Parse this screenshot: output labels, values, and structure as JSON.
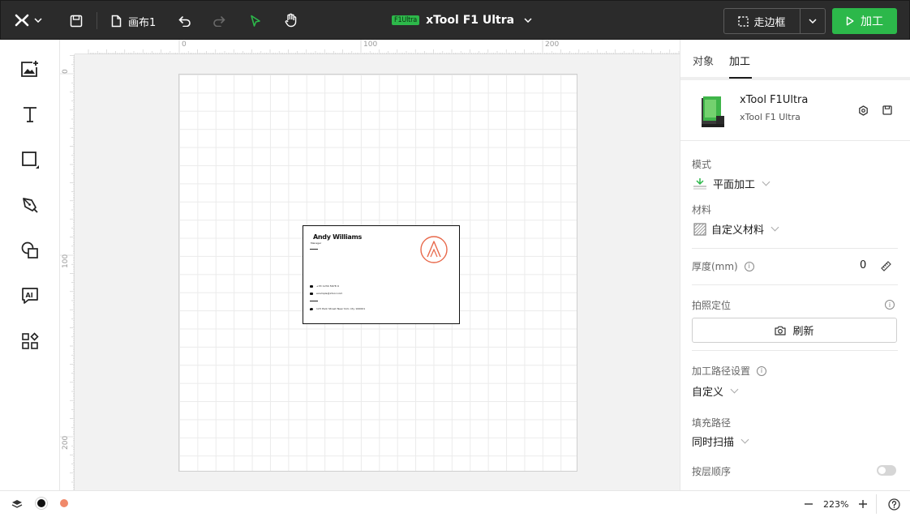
{
  "topbar": {
    "canvas_name": "画布1",
    "device_badge": "F1Ultra",
    "device_title": "xTool F1 Ultra",
    "frame_label": "走边框",
    "process_label": "加工"
  },
  "ruler": {
    "top_ticks": [
      "0",
      "100",
      "200"
    ],
    "left_ticks": [
      "0",
      "100",
      "200"
    ]
  },
  "card": {
    "name": "Andy Williams",
    "role": "Manager",
    "phone": "+33 1234 5678 9",
    "email": "example@xtool.com",
    "address": "123 Park Street New York city 100001"
  },
  "panel": {
    "tabs": [
      "对象",
      "加工"
    ],
    "active_tab": "加工",
    "device_name": "xTool F1Ultra",
    "device_model": "xTool F1 Ultra",
    "mode_label": "模式",
    "mode_value": "平面加工",
    "material_label": "材料",
    "material_value": "自定义材料",
    "thickness_label": "厚度(mm)",
    "thickness_value": "0",
    "camera_label": "拍照定位",
    "refresh_label": "刷新",
    "path_label": "加工路径设置",
    "path_value": "自定义",
    "fill_label": "填充路径",
    "fill_value": "同时扫描",
    "layer_order_label": "按层顺序"
  },
  "bottombar": {
    "zoom": "223%"
  },
  "colors": {
    "accent_green": "#2cb84a",
    "logo_orange": "#e8684a",
    "layer_black": "#111111",
    "layer_orange": "#f0896a"
  }
}
